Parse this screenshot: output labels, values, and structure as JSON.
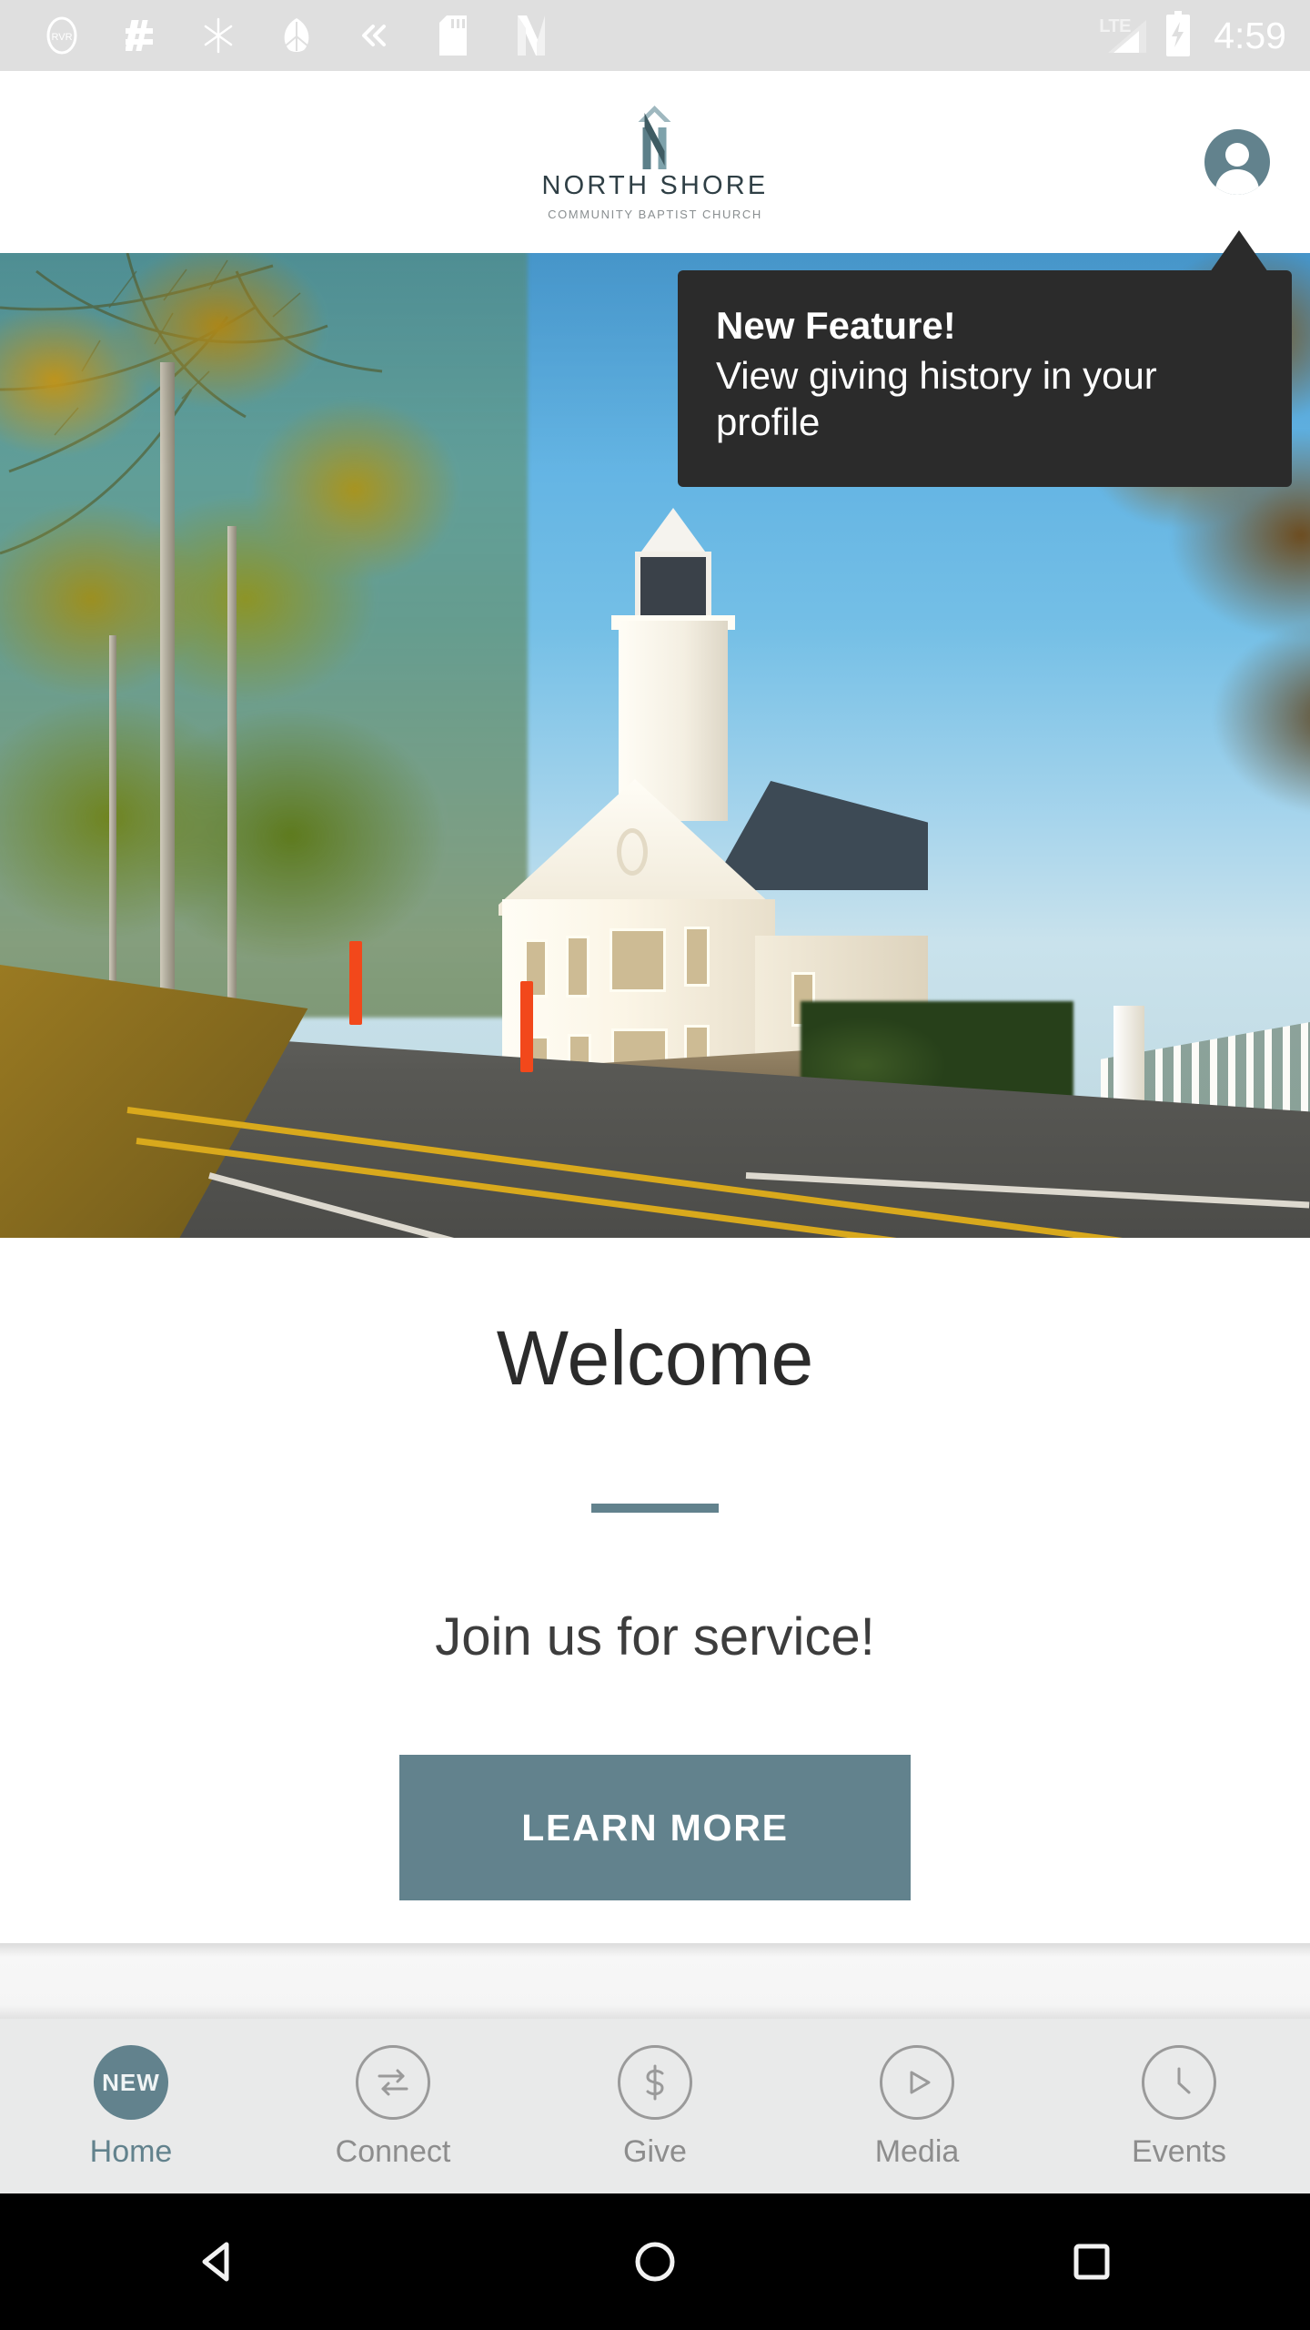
{
  "status_bar": {
    "time": "4:59",
    "network": "LTE",
    "battery_state": "charging",
    "notification_icons": [
      "rvr-app-icon",
      "hashtag-app-icon",
      "asterisk-app-icon",
      "leaf-app-icon",
      "double-chevron-left-icon",
      "sd-card-icon",
      "netflix-n-icon"
    ]
  },
  "header": {
    "logo_name": "NORTH SHORE",
    "logo_subtitle": "COMMUNITY BAPTIST CHURCH",
    "logo_mark": "steeple-n-icon",
    "avatar_icon": "profile-avatar-icon"
  },
  "tooltip": {
    "title": "New Feature!",
    "body": "View giving history in your profile",
    "background_color": "#2b2b2b",
    "points_to": "profile-avatar"
  },
  "hero": {
    "description": "Photograph of a white New England church with steeple beside an autumn-lined road"
  },
  "content": {
    "heading": "Welcome",
    "tagline": "Join us for service!",
    "cta_label": "LEARN MORE",
    "divider_color": "#62828d",
    "cta_color": "#62828d"
  },
  "tab_bar": {
    "active_index": 0,
    "items": [
      {
        "label": "Home",
        "icon": "new-badge-icon",
        "badge": "NEW",
        "active": true
      },
      {
        "label": "Connect",
        "icon": "exchange-arrows-icon",
        "badge": "",
        "active": false
      },
      {
        "label": "Give",
        "icon": "dollar-sign-icon",
        "badge": "",
        "active": false
      },
      {
        "label": "Media",
        "icon": "play-circle-icon",
        "badge": "",
        "active": false
      },
      {
        "label": "Events",
        "icon": "clock-icon",
        "badge": "",
        "active": false
      }
    ],
    "active_color": "#62828d",
    "inactive_color": "#8d8d8d"
  },
  "android_nav": {
    "buttons": [
      "back-triangle-icon",
      "home-circle-icon",
      "recents-square-icon"
    ]
  }
}
